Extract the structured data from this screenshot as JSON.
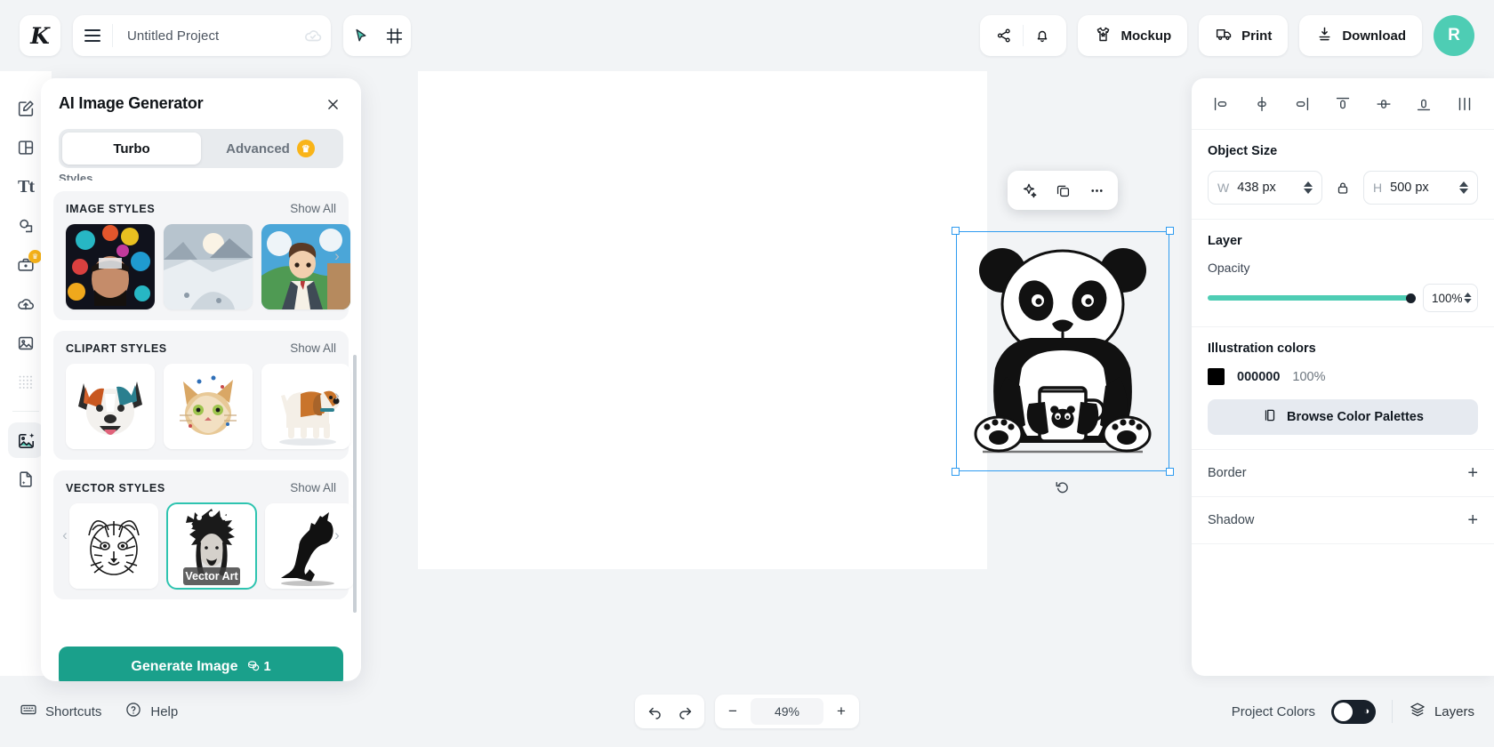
{
  "app": {
    "logo_letter": "K",
    "accent": "#1aa08b",
    "accent_light": "#4ecdb4",
    "selection_blue": "#2e9bf0"
  },
  "topbar": {
    "project_name": "Untitled Project",
    "project_name_placeholder": "Untitled Project",
    "cloud_status_icon": "cloud-check-icon",
    "menu_icon": "hamburger-menu-icon",
    "tools": [
      {
        "name": "select-tool",
        "icon": "cursor-arrow-icon"
      },
      {
        "name": "frame-tool",
        "icon": "artboard-frame-icon"
      }
    ],
    "share_icon": "share-nodes-icon",
    "notifications_icon": "bell-icon",
    "buttons": [
      {
        "label": "Mockup",
        "icon": "tshirt-icon"
      },
      {
        "label": "Print",
        "icon": "delivery-truck-icon"
      },
      {
        "label": "Download",
        "icon": "download-icon"
      }
    ],
    "avatar_initial": "R"
  },
  "rail": {
    "items": [
      {
        "name": "sidebar-item-design",
        "icon": "edit-square-icon",
        "active": false
      },
      {
        "name": "sidebar-item-templates",
        "icon": "layout-template-icon",
        "active": false
      },
      {
        "name": "sidebar-item-text",
        "icon": "text-tt-icon",
        "active": false
      },
      {
        "name": "sidebar-item-shapes",
        "icon": "shapes-icon",
        "active": false
      },
      {
        "name": "sidebar-item-brandkit",
        "icon": "briefcase-icon",
        "active": false,
        "badge": "crown-badge"
      },
      {
        "name": "sidebar-item-uploads",
        "icon": "cloud-upload-icon",
        "active": false
      },
      {
        "name": "sidebar-item-images",
        "icon": "picture-icon",
        "active": false
      },
      {
        "name": "sidebar-item-patterns",
        "icon": "dot-grid-icon",
        "active": false
      },
      {
        "name": "sidebar-item-ai-image-generator",
        "icon": "ai-image-sparkle-icon",
        "active": true
      },
      {
        "name": "sidebar-item-ai-file",
        "icon": "file-sparkle-icon",
        "active": false
      }
    ]
  },
  "ai_panel": {
    "title": "AI Image Generator",
    "close_icon": "close-icon",
    "tabs": [
      {
        "label": "Turbo",
        "active": true
      },
      {
        "label": "Advanced",
        "active": false,
        "badge": "crown-icon"
      }
    ],
    "styles_label": "Styles",
    "groups": [
      {
        "title": "IMAGE STYLES",
        "show_all": "Show All",
        "thumbs": [
          {
            "name": "style-thumb-floral-portrait",
            "caption": ""
          },
          {
            "name": "style-thumb-snowy-valley",
            "caption": ""
          },
          {
            "name": "style-thumb-anime-boy",
            "caption": ""
          }
        ]
      },
      {
        "title": "CLIPART STYLES",
        "show_all": "Show All",
        "thumbs": [
          {
            "name": "style-thumb-colorful-dog",
            "caption": ""
          },
          {
            "name": "style-thumb-watercolor-cat",
            "caption": ""
          },
          {
            "name": "style-thumb-beagle",
            "caption": ""
          }
        ]
      },
      {
        "title": "VECTOR STYLES",
        "show_all": "Show All",
        "thumbs": [
          {
            "name": "style-thumb-tiger-line",
            "caption": ""
          },
          {
            "name": "style-thumb-vector-art",
            "caption": "Vector Art",
            "selected": true
          },
          {
            "name": "style-thumb-howling-wolf",
            "caption": ""
          }
        ]
      }
    ],
    "generate_button": "Generate Image",
    "generate_credits": "1",
    "credits_icon": "coins-icon"
  },
  "canvas": {
    "object_toolbar": [
      {
        "name": "ai-magic-button",
        "icon": "sparkle-icon"
      },
      {
        "name": "duplicate-button",
        "icon": "copy-icon"
      },
      {
        "name": "more-options-button",
        "icon": "ellipsis-icon"
      }
    ],
    "rotate_handle_icon": "rotate-icon",
    "object_alt": "black and white panda holding a coffee mug illustration"
  },
  "right_panel": {
    "align_buttons": [
      {
        "name": "align-left-icon"
      },
      {
        "name": "align-center-horizontal-icon"
      },
      {
        "name": "align-right-icon"
      },
      {
        "name": "align-top-icon"
      },
      {
        "name": "align-middle-vertical-icon"
      },
      {
        "name": "align-bottom-icon"
      },
      {
        "name": "distribute-icon"
      }
    ],
    "object_size": {
      "title": "Object Size",
      "width_label": "W",
      "width_value": "438 px",
      "height_label": "H",
      "height_value": "500 px",
      "lock_icon": "lock-aspect-ratio-icon"
    },
    "layer": {
      "title": "Layer",
      "opacity_label": "Opacity",
      "opacity_value": "100%",
      "opacity_pct": 100
    },
    "illustration_colors": {
      "title": "Illustration colors",
      "swatch_hex": "000000",
      "swatch_color": "#000000",
      "swatch_opacity": "100%",
      "browse_label": "Browse Color Palettes",
      "browse_icon": "palette-icon"
    },
    "border": {
      "title": "Border",
      "expand_icon": "plus-icon"
    },
    "shadow": {
      "title": "Shadow",
      "expand_icon": "plus-icon"
    }
  },
  "bottombar": {
    "shortcuts_label": "Shortcuts",
    "shortcuts_icon": "keyboard-icon",
    "help_label": "Help",
    "help_icon": "question-circle-icon",
    "undo_icon": "undo-arrow-icon",
    "redo_icon": "redo-arrow-icon",
    "zoom_out_label": "−",
    "zoom_value": "49%",
    "zoom_in_label": "+",
    "project_colors_label": "Project Colors",
    "layers_label": "Layers",
    "layers_icon": "layers-icon"
  }
}
